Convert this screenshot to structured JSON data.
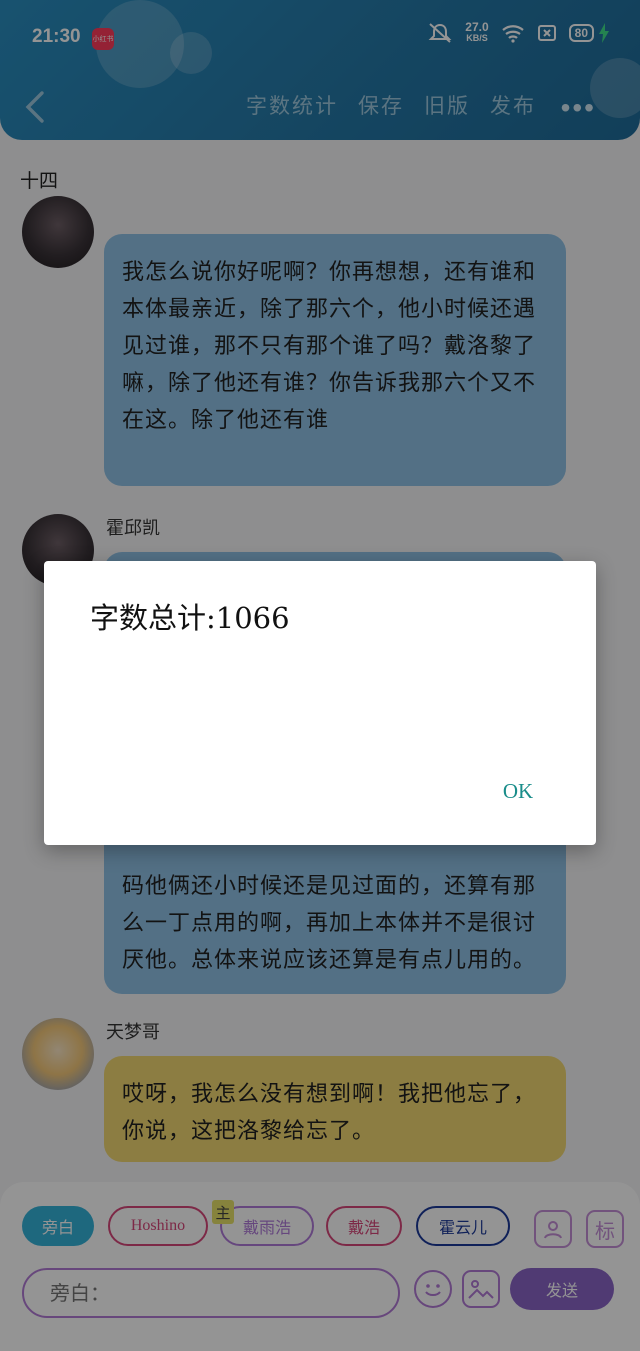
{
  "status_bar": {
    "time": "21:30",
    "app_badge": "小红书",
    "net_speed_value": "27.0",
    "net_speed_unit": "KB/S",
    "battery": "80"
  },
  "toolbar": {
    "items": [
      "字数统计",
      "保存",
      "旧版",
      "发布"
    ],
    "more": "•••"
  },
  "chapter_title": "十四",
  "messages": [
    {
      "sender": "",
      "text": "我怎么说你好呢啊？你再想想，还有谁和本体最亲近，除了那六个，他小时候还遇见过谁，那不只有那个谁了吗？戴洛黎了嘛，除了他还有谁？你告诉我那六个又不在这。除了他还有谁"
    },
    {
      "sender": "霍邱凯",
      "text": "",
      "text_visible": "码他俩还小时候还是见过面的，还算有那么一丁点用的啊，再加上本体并不是很讨厌他。总体来说应该还算是有点儿用的。"
    },
    {
      "sender": "天梦哥",
      "text": "哎呀，我怎么没有想到啊！我把他忘了，你说，这把洛黎给忘了。"
    }
  ],
  "dialog": {
    "message": "字数总计:1066",
    "ok_label": "OK"
  },
  "panel": {
    "chips": [
      "旁白",
      "Hoshino",
      "戴雨浩",
      "戴浩",
      "霍云儿"
    ],
    "chip_badge": "主",
    "input_placeholder": "旁白：",
    "send_label": "发送",
    "side_icon_label": "标"
  },
  "colors": {
    "header": "#2579a8",
    "bubble_blue": "#8fc2e6",
    "bubble_yellow": "#f2d873",
    "accent_teal": "#35b3da",
    "send_purple": "#8a64c7",
    "ok_teal": "#1a8d8a"
  }
}
